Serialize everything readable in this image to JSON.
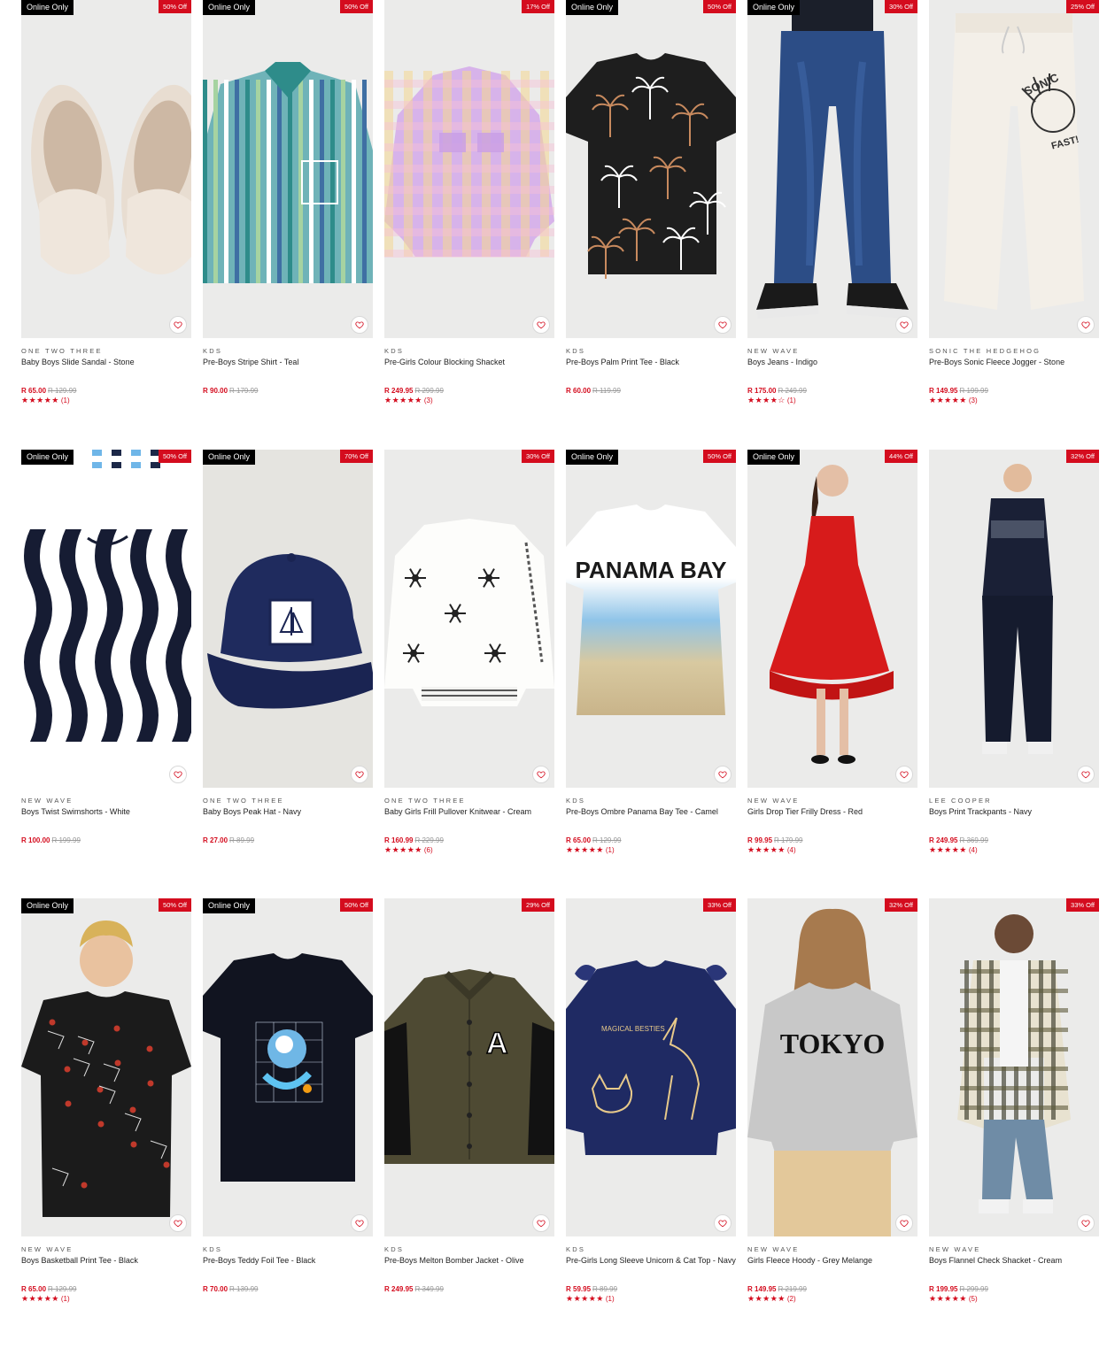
{
  "colors": {
    "sale": "#d40c1e",
    "online_badge": "#000000",
    "star": "#d40c1e"
  },
  "products": [
    {
      "online": "Online Only",
      "discount": "50% Off",
      "brand": "ONE TWO THREE",
      "name": "Baby Boys Slide Sandal - Stone",
      "price": "R 65.00",
      "was": "R 129.99",
      "stars": "★★★★★",
      "count": "(1)",
      "art": "sandals",
      "bg": "#ebebea"
    },
    {
      "online": "Online Only",
      "discount": "50% Off",
      "brand": "KDS",
      "name": "Pre-Boys Stripe Shirt - Teal",
      "price": "R 90.00",
      "was": "R 179.99",
      "stars": "",
      "count": "",
      "art": "shirt",
      "bg": "#ebebea"
    },
    {
      "online": "",
      "discount": "17% Off",
      "brand": "KDS",
      "name": "Pre-Girls Colour Blocking Shacket",
      "price": "R 249.95",
      "was": "R 299.99",
      "stars": "★★★★★",
      "count": "(3)",
      "art": "shacket",
      "bg": "#ebebea"
    },
    {
      "online": "Online Only",
      "discount": "50% Off",
      "brand": "KDS",
      "name": "Pre-Boys Palm Print Tee - Black",
      "price": "R 60.00",
      "was": "R 119.99",
      "stars": "",
      "count": "",
      "art": "palmtee",
      "bg": "#ebebea"
    },
    {
      "online": "Online Only",
      "discount": "30% Off",
      "brand": "NEW WAVE",
      "name": "Boys Jeans - Indigo",
      "price": "R 175.00",
      "was": "R 249.99",
      "stars": "★★★★☆",
      "count": "(1)",
      "art": "jeans",
      "bg": "#ebebea"
    },
    {
      "online": "",
      "discount": "25% Off",
      "brand": "SONIC THE HEDGEHOG",
      "name": "Pre-Boys Sonic Fleece Jogger - Stone",
      "price": "R 149.95",
      "was": "R 199.99",
      "stars": "★★★★★",
      "count": "(3)",
      "art": "jogger",
      "bg": "#ebebea"
    },
    {
      "online": "Online Only",
      "discount": "50% Off",
      "brand": "NEW WAVE",
      "name": "Boys Twist Swimshorts - White",
      "price": "R 100.00",
      "was": "R 199.99",
      "stars": "",
      "count": "",
      "art": "swim",
      "bg": "#ebebea"
    },
    {
      "online": "Online Only",
      "discount": "70% Off",
      "brand": "ONE TWO THREE",
      "name": "Baby Boys Peak Hat - Navy",
      "price": "R 27.00",
      "was": "R 89.99",
      "stars": "",
      "count": "",
      "art": "hat",
      "bg": "#e5e4e0"
    },
    {
      "online": "",
      "discount": "30% Off",
      "brand": "ONE TWO THREE",
      "name": "Baby Girls Frill Pullover Knitwear - Cream",
      "price": "R 160.99",
      "was": "R 229.99",
      "stars": "★★★★★",
      "count": "(6)",
      "art": "knit",
      "bg": "#ebebea"
    },
    {
      "online": "Online Only",
      "discount": "50% Off",
      "brand": "KDS",
      "name": "Pre-Boys Ombre Panama Bay Tee - Camel",
      "price": "R 65.00",
      "was": "R 129.99",
      "stars": "★★★★★",
      "count": "(1)",
      "art": "ombre",
      "bg": "#ebebea"
    },
    {
      "online": "Online Only",
      "discount": "44% Off",
      "brand": "NEW WAVE",
      "name": "Girls Drop Tier Frilly Dress - Red",
      "price": "R 99.95",
      "was": "R 179.99",
      "stars": "★★★★★",
      "count": "(4)",
      "art": "dress",
      "bg": "#ebebea"
    },
    {
      "online": "",
      "discount": "32% Off",
      "brand": "LEE COOPER",
      "name": "Boys Print Trackpants - Navy",
      "price": "R 249.95",
      "was": "R 369.99",
      "stars": "★★★★★",
      "count": "(4)",
      "art": "track",
      "bg": "#ebebea"
    },
    {
      "online": "Online Only",
      "discount": "50% Off",
      "brand": "NEW WAVE",
      "name": "Boys Basketball Print Tee - Black",
      "price": "R 65.00",
      "was": "R 129.99",
      "stars": "★★★★★",
      "count": "(1)",
      "art": "bball",
      "bg": "#ebebea"
    },
    {
      "online": "Online Only",
      "discount": "50% Off",
      "brand": "KDS",
      "name": "Pre-Boys Teddy Foil Tee - Black",
      "price": "R 70.00",
      "was": "R 139.99",
      "stars": "",
      "count": "",
      "art": "teddy",
      "bg": "#ebebea"
    },
    {
      "online": "",
      "discount": "29% Off",
      "brand": "KDS",
      "name": "Pre-Boys Melton Bomber Jacket - Olive",
      "price": "R 249.95",
      "was": "R 349.99",
      "stars": "",
      "count": "",
      "art": "bomber",
      "bg": "#ebebea"
    },
    {
      "online": "",
      "discount": "33% Off",
      "brand": "KDS",
      "name": "Pre-Girls Long Sleeve Unicorn & Cat Top - Navy",
      "price": "R 59.95",
      "was": "R 89.99",
      "stars": "★★★★★",
      "count": "(1)",
      "art": "unicorn",
      "bg": "#ebebea"
    },
    {
      "online": "",
      "discount": "32% Off",
      "brand": "NEW WAVE",
      "name": "Girls Fleece Hoody - Grey Melange",
      "price": "R 149.95",
      "was": "R 219.99",
      "stars": "★★★★★",
      "count": "(2)",
      "art": "tokyo",
      "bg": "#ebebea"
    },
    {
      "online": "",
      "discount": "33% Off",
      "brand": "NEW WAVE",
      "name": "Boys Flannel Check Shacket - Cream",
      "price": "R 199.95",
      "was": "R 299.99",
      "stars": "★★★★★",
      "count": "(5)",
      "art": "flannel",
      "bg": "#ebebea"
    }
  ],
  "art_text": {
    "panama": "PANAMA BAY",
    "tokyo": "TOKYO",
    "sonic": "SONIC FAST!",
    "cat": "MAGICAL BESTIES"
  }
}
